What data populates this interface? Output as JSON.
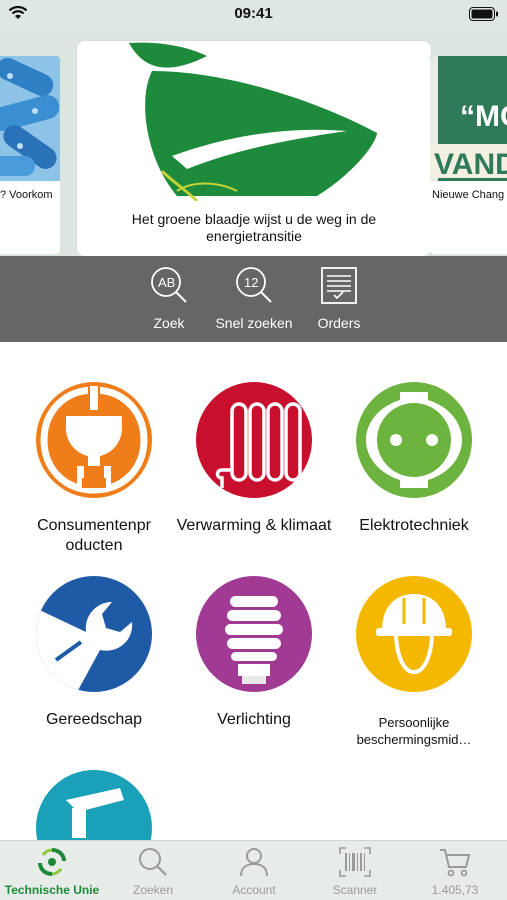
{
  "status_bar": {
    "time": "09:41"
  },
  "carousel": {
    "left_caption": "? Voorkom",
    "main_caption": "Het groene blaadje wijst u de weg in de energietransitie",
    "right_caption": "Nieuwe Chang",
    "right_banner_text_1": "“MO",
    "right_banner_text_2": "VANDA"
  },
  "quick_actions": [
    {
      "label": "Zoek",
      "icon": "search-ab-icon",
      "glyph": "AB"
    },
    {
      "label": "Snel zoeken",
      "icon": "search-12-icon",
      "glyph": "12"
    },
    {
      "label": "Orders",
      "icon": "orders-icon"
    }
  ],
  "categories": [
    {
      "label": "Consumentenpr oducten",
      "icon": "plug-icon",
      "color": "#ef7d1a"
    },
    {
      "label": "Verwarming & klimaat",
      "icon": "radiator-icon",
      "color": "#c8102e"
    },
    {
      "label": "Elektrotechniek",
      "icon": "socket-icon",
      "color": "#6db33f"
    },
    {
      "label": "Gereedschap",
      "icon": "wrench-icon",
      "color": "#1f5aa6"
    },
    {
      "label": "Verlichting",
      "icon": "bulb-icon",
      "color": "#a13a93"
    },
    {
      "label": "Persoonlijke beschermingsmid…",
      "icon": "helmet-icon",
      "color": "#f5b800"
    },
    {
      "label": "",
      "icon": "faucet-icon",
      "color": "#1aa0b8"
    }
  ],
  "tab_bar": [
    {
      "label": "Technische Unie",
      "icon": "tu-logo-icon",
      "active": true
    },
    {
      "label": "Zoeken",
      "icon": "search-icon",
      "active": false
    },
    {
      "label": "Account",
      "icon": "account-icon",
      "active": false
    },
    {
      "label": "Scanner",
      "icon": "barcode-icon",
      "active": false
    },
    {
      "label": "1.405,73",
      "icon": "cart-icon",
      "active": false
    }
  ],
  "colors": {
    "accent": "#1d8a3b",
    "quick_bar": "#666666"
  }
}
